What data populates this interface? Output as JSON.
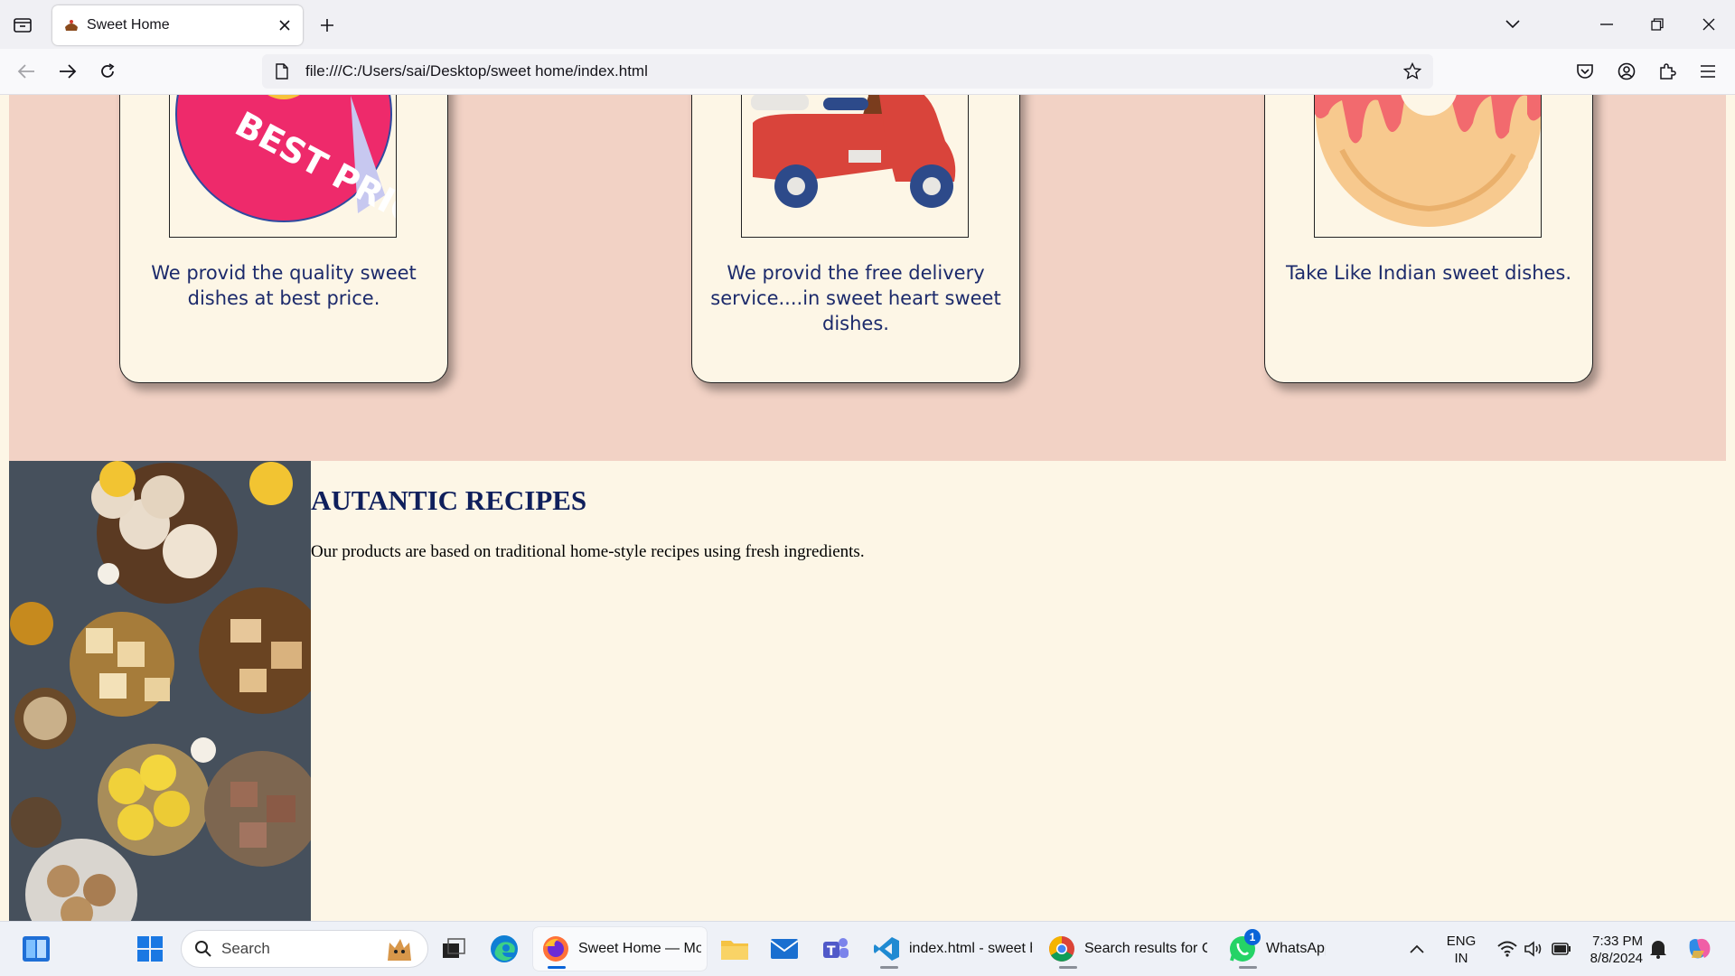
{
  "browser": {
    "tab_title": "Sweet Home",
    "url": "file:///C:/Users/sai/Desktop/sweet home/index.html"
  },
  "page": {
    "cards": [
      {
        "text": "We provid the quality sweet dishes at best price.",
        "image_caption": "BEST PRICE"
      },
      {
        "text": "We provid the free delivery service....in sweet heart sweet dishes."
      },
      {
        "text": "Take Like Indian sweet dishes."
      }
    ],
    "recipes": {
      "title": "AUTANTIC RECIPES",
      "description": "Our products are based on traditional home-style recipes using fresh ingredients."
    }
  },
  "taskbar": {
    "search_label": "Search",
    "apps": [
      {
        "label": "Sweet Home — Mozilla Firefox",
        "icon": "firefox-icon"
      },
      {
        "label": "index.html - sweet home - Visual Studio Code",
        "icon": "vscode-icon"
      },
      {
        "label": "Search results for Cookies",
        "icon": "chrome-icon"
      },
      {
        "label": "WhatsApp",
        "icon": "whatsapp-icon",
        "badge": "1"
      }
    ],
    "tray": {
      "lang_line1": "ENG",
      "lang_line2": "IN",
      "time": "7:33 PM",
      "date": "8/8/2024"
    }
  },
  "colors": {
    "services_bg": "#f2d2c5",
    "page_bg": "#fdf6e6",
    "card_text": "#1c2a6b",
    "heading": "#0f1f5c"
  }
}
